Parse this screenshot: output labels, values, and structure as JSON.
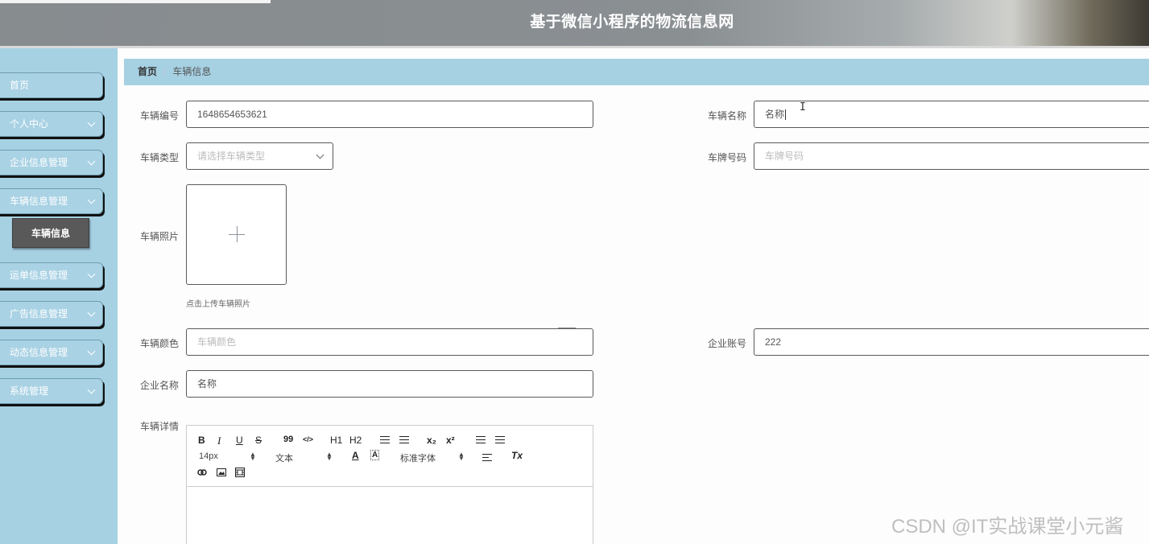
{
  "header": {
    "title": "基于微信小程序的物流信息网"
  },
  "sidebar": {
    "items": [
      {
        "label": "首页",
        "has_arrow": false
      },
      {
        "label": "个人中心",
        "has_arrow": true
      },
      {
        "label": "企业信息管理",
        "has_arrow": true
      },
      {
        "label": "车辆信息管理",
        "has_arrow": true
      },
      {
        "label": "运单信息管理",
        "has_arrow": true
      },
      {
        "label": "广告信息管理",
        "has_arrow": true
      },
      {
        "label": "动态信息管理",
        "has_arrow": true
      },
      {
        "label": "系统管理",
        "has_arrow": true
      }
    ],
    "submenu": {
      "label": "车辆信息"
    }
  },
  "breadcrumb": {
    "home": "首页",
    "separator": "/",
    "current": "车辆信息"
  },
  "form": {
    "vehicle_no": {
      "label": "车辆编号",
      "value": "1648654653621"
    },
    "vehicle_name": {
      "label": "车辆名称",
      "value": "名称"
    },
    "vehicle_type": {
      "label": "车辆类型",
      "placeholder": "请选择车辆类型"
    },
    "plate_no": {
      "label": "车牌号码",
      "placeholder": "车牌号码"
    },
    "photo": {
      "label": "车辆照片",
      "tip": "点击上传车辆照片"
    },
    "color": {
      "label": "车辆颜色",
      "placeholder": "车辆颜色"
    },
    "company_account": {
      "label": "企业账号",
      "value": "222"
    },
    "company_name": {
      "label": "企业名称",
      "value": "名称"
    },
    "details": {
      "label": "车辆详情"
    }
  },
  "editor": {
    "row1": [
      "B",
      "I",
      "U",
      "S",
      "99",
      "</>",
      "H1",
      "H2",
      "ol-list",
      "ul-list",
      "x₂",
      "x²",
      "outdent",
      "indent"
    ],
    "size_picker": "14px",
    "header_picker": "文本",
    "font_picker": "标准字体",
    "color_glyph": "A",
    "clean_glyph": "Tx"
  },
  "watermark": "CSDN @IT实战课堂小元酱"
}
